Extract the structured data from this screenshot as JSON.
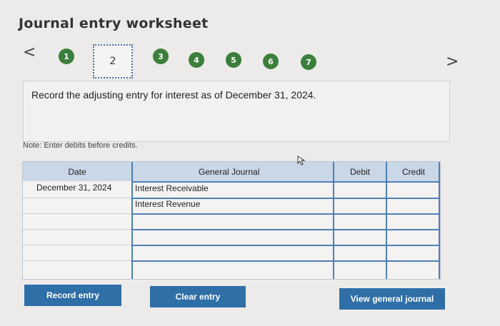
{
  "header": {
    "title": "Journal entry worksheet"
  },
  "nav": {
    "prev": "<",
    "next": ">",
    "steps": [
      "1",
      "2",
      "3",
      "4",
      "5",
      "6",
      "7"
    ],
    "current_step": "2"
  },
  "instruction": "Record the adjusting entry for interest as of December 31, 2024.",
  "note": "Note: Enter debits before credits.",
  "table": {
    "headers": {
      "date": "Date",
      "journal": "General Journal",
      "debit": "Debit",
      "credit": "Credit"
    },
    "rows": [
      {
        "date": "December 31, 2024",
        "account": "Interest Receivable",
        "debit": "",
        "credit": ""
      },
      {
        "date": "",
        "account": "Interest Revenue",
        "debit": "",
        "credit": ""
      },
      {
        "date": "",
        "account": "",
        "debit": "",
        "credit": ""
      },
      {
        "date": "",
        "account": "",
        "debit": "",
        "credit": ""
      },
      {
        "date": "",
        "account": "",
        "debit": "",
        "credit": ""
      },
      {
        "date": "",
        "account": "",
        "debit": "",
        "credit": ""
      }
    ]
  },
  "buttons": {
    "record": "Record entry",
    "clear": "Clear entry",
    "view": "View general journal"
  }
}
